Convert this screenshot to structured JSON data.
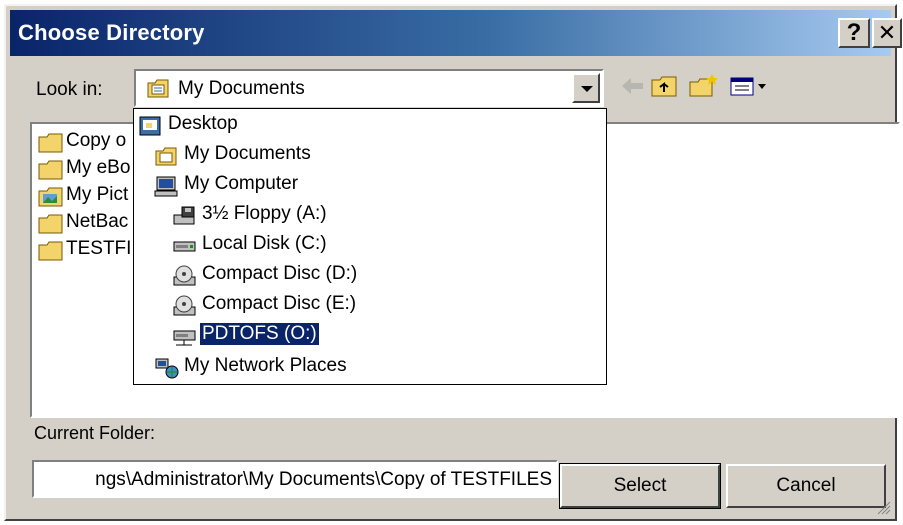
{
  "window": {
    "title": "Choose Directory",
    "help_label": "?",
    "close_label": "✕"
  },
  "lookin": {
    "label": "Look in:",
    "value": "My Documents"
  },
  "file_list": {
    "items": [
      {
        "label": "Copy o",
        "icon": "folder-icon"
      },
      {
        "label": "My eBo",
        "icon": "folder-icon"
      },
      {
        "label": "My Pict",
        "icon": "pictures-folder-icon"
      },
      {
        "label": "NetBac",
        "icon": "folder-icon"
      },
      {
        "label": "TESTFI",
        "icon": "folder-icon"
      }
    ]
  },
  "dropdown": {
    "items": [
      {
        "label": "Desktop",
        "icon": "desktop-icon",
        "indent": 0
      },
      {
        "label": "My Documents",
        "icon": "my-documents-icon",
        "indent": 1
      },
      {
        "label": "My Computer",
        "icon": "my-computer-icon",
        "indent": 1
      },
      {
        "label": "3½ Floppy (A:)",
        "icon": "floppy-drive-icon",
        "indent": 2
      },
      {
        "label": "Local Disk (C:)",
        "icon": "hard-disk-icon",
        "indent": 2
      },
      {
        "label": "Compact Disc (D:)",
        "icon": "cd-drive-icon",
        "indent": 2
      },
      {
        "label": "Compact Disc (E:)",
        "icon": "cd-drive-icon",
        "indent": 2
      },
      {
        "label": "PDTOFS (O:)",
        "icon": "network-drive-icon",
        "indent": 2,
        "selected": true
      },
      {
        "label": "My Network Places",
        "icon": "network-places-icon",
        "indent": 1
      }
    ]
  },
  "current_folder": {
    "label": "Current Folder:",
    "path": "ngs\\Administrator\\My Documents\\Copy of TESTFILES"
  },
  "buttons": {
    "select_label": "Select",
    "cancel_label": "Cancel"
  },
  "colors": {
    "titlebar_start": "#0a246a",
    "titlebar_end": "#a6caf0",
    "dialog_face": "#d4d0c8",
    "selection": "#0a246a"
  }
}
